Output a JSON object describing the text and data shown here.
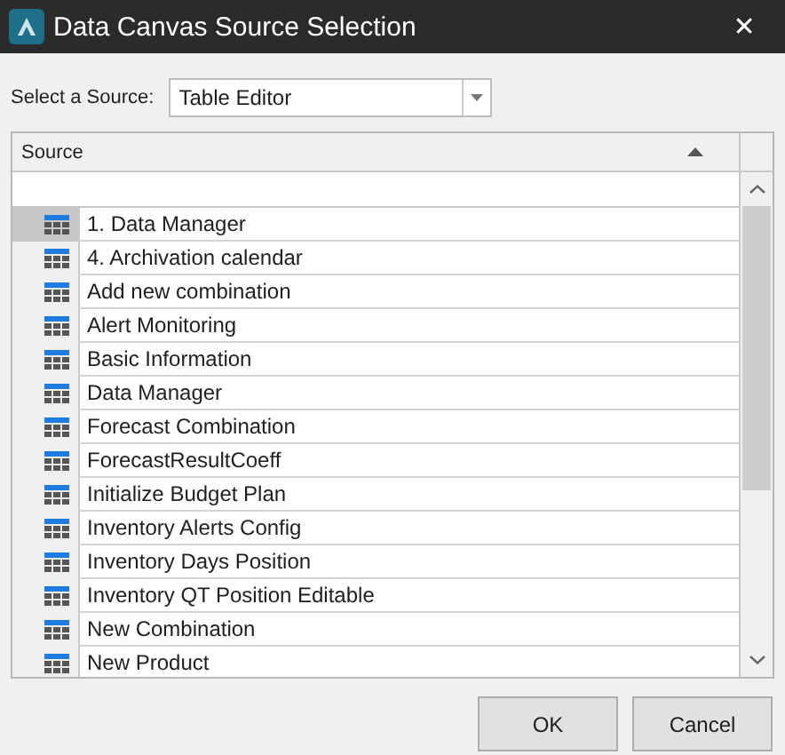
{
  "window": {
    "title": "Data Canvas Source Selection",
    "close": "✕"
  },
  "source_select": {
    "label": "Select a Source:",
    "value": "Table Editor"
  },
  "table": {
    "columns": [
      {
        "label": "Source",
        "sorted": true
      }
    ],
    "rows": [
      {
        "label": "1. Data Manager",
        "selected": true
      },
      {
        "label": "4. Archivation calendar",
        "selected": false
      },
      {
        "label": "Add new combination",
        "selected": false
      },
      {
        "label": "Alert Monitoring",
        "selected": false
      },
      {
        "label": "Basic Information",
        "selected": false
      },
      {
        "label": "Data Manager",
        "selected": false
      },
      {
        "label": "Forecast Combination",
        "selected": false
      },
      {
        "label": "ForecastResultCoeff",
        "selected": false
      },
      {
        "label": "Initialize Budget Plan",
        "selected": false
      },
      {
        "label": "Inventory Alerts Config",
        "selected": false
      },
      {
        "label": "Inventory Days Position",
        "selected": false
      },
      {
        "label": "Inventory QT Position Editable",
        "selected": false
      },
      {
        "label": "New Combination",
        "selected": false
      },
      {
        "label": "New Product",
        "selected": false
      }
    ]
  },
  "buttons": [
    "OK",
    "Cancel"
  ]
}
